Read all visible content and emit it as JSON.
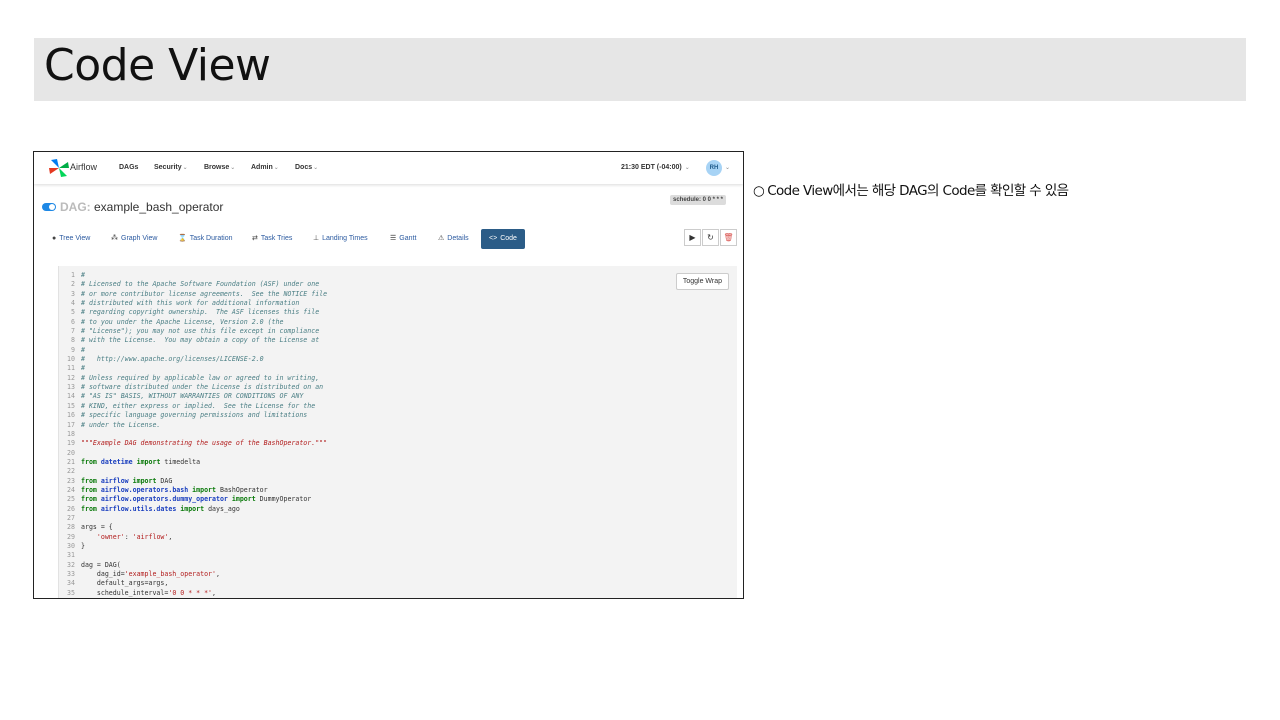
{
  "slide": {
    "title": "Code View",
    "note_bullet": "○",
    "note_text": "Code View에서는 해당 DAG의 Code를 확인할 수 있음"
  },
  "navbar": {
    "brand": "Airflow",
    "items": [
      "DAGs",
      "Security",
      "Browse",
      "Admin",
      "Docs"
    ],
    "clock": "21:30 EDT (-04:00)",
    "avatar": "RH",
    "caret": "⌄"
  },
  "dag": {
    "prefix": "DAG:",
    "name": "example_bash_operator",
    "schedule": "schedule: 0 0 * * *"
  },
  "tabs": [
    {
      "label": "Tree View",
      "icon": "tree-icon"
    },
    {
      "label": "Graph View",
      "icon": "graph-icon"
    },
    {
      "label": "Task Duration",
      "icon": "hourglass-icon"
    },
    {
      "label": "Task Tries",
      "icon": "retry-icon"
    },
    {
      "label": "Landing Times",
      "icon": "plane-landing-icon"
    },
    {
      "label": "Gantt",
      "icon": "gantt-icon"
    },
    {
      "label": "Details",
      "icon": "warning-triangle-icon"
    },
    {
      "label": "Code",
      "icon": "code-icon"
    }
  ],
  "actions": {
    "trigger": "▶",
    "refresh": "↻",
    "delete": "🗑"
  },
  "code_panel": {
    "toggle_wrap": "Toggle Wrap",
    "lines": [
      [
        [
          "c",
          "#"
        ]
      ],
      [
        [
          "c",
          "# Licensed to the Apache Software Foundation (ASF) under one"
        ]
      ],
      [
        [
          "c",
          "# or more contributor license agreements.  See the NOTICE file"
        ]
      ],
      [
        [
          "c",
          "# distributed with this work for additional information"
        ]
      ],
      [
        [
          "c",
          "# regarding copyright ownership.  The ASF licenses this file"
        ]
      ],
      [
        [
          "c",
          "# to you under the Apache License, Version 2.0 (the"
        ]
      ],
      [
        [
          "c",
          "# \"License\"); you may not use this file except in compliance"
        ]
      ],
      [
        [
          "c",
          "# with the License.  You may obtain a copy of the License at"
        ]
      ],
      [
        [
          "c",
          "#"
        ]
      ],
      [
        [
          "c",
          "#   http://www.apache.org/licenses/LICENSE-2.0"
        ]
      ],
      [
        [
          "c",
          "#"
        ]
      ],
      [
        [
          "c",
          "# Unless required by applicable law or agreed to in writing,"
        ]
      ],
      [
        [
          "c",
          "# software distributed under the License is distributed on an"
        ]
      ],
      [
        [
          "c",
          "# \"AS IS\" BASIS, WITHOUT WARRANTIES OR CONDITIONS OF ANY"
        ]
      ],
      [
        [
          "c",
          "# KIND, either express or implied.  See the License for the"
        ]
      ],
      [
        [
          "c",
          "# specific language governing permissions and limitations"
        ]
      ],
      [
        [
          "c",
          "# under the License."
        ]
      ],
      [],
      [
        [
          "d",
          "\"\"\"Example DAG demonstrating the usage of the BashOperator.\"\"\""
        ]
      ],
      [],
      [
        [
          "k",
          "from "
        ],
        [
          "m",
          "datetime"
        ],
        [
          "k",
          " import "
        ],
        [
          "p",
          "timedelta"
        ]
      ],
      [],
      [
        [
          "k",
          "from "
        ],
        [
          "m",
          "airflow"
        ],
        [
          "k",
          " import "
        ],
        [
          "p",
          "DAG"
        ]
      ],
      [
        [
          "k",
          "from "
        ],
        [
          "m",
          "airflow.operators.bash"
        ],
        [
          "k",
          " import "
        ],
        [
          "p",
          "BashOperator"
        ]
      ],
      [
        [
          "k",
          "from "
        ],
        [
          "m",
          "airflow.operators.dummy_operator"
        ],
        [
          "k",
          " import "
        ],
        [
          "p",
          "DummyOperator"
        ]
      ],
      [
        [
          "k",
          "from "
        ],
        [
          "m",
          "airflow.utils.dates"
        ],
        [
          "k",
          " import "
        ],
        [
          "p",
          "days_ago"
        ]
      ],
      [],
      [
        [
          "p",
          "args = {"
        ]
      ],
      [
        [
          "p",
          "    "
        ],
        [
          "s",
          "'owner'"
        ],
        [
          "p",
          ": "
        ],
        [
          "s",
          "'airflow'"
        ],
        [
          "p",
          ","
        ]
      ],
      [
        [
          "p",
          "}"
        ]
      ],
      [],
      [
        [
          "p",
          "dag = DAG("
        ]
      ],
      [
        [
          "p",
          "    dag_id="
        ],
        [
          "s",
          "'example_bash_operator'"
        ],
        [
          "p",
          ","
        ]
      ],
      [
        [
          "p",
          "    default_args=args,"
        ]
      ],
      [
        [
          "p",
          "    schedule_interval="
        ],
        [
          "s",
          "'0 0 * * *'"
        ],
        [
          "p",
          ","
        ]
      ]
    ]
  }
}
